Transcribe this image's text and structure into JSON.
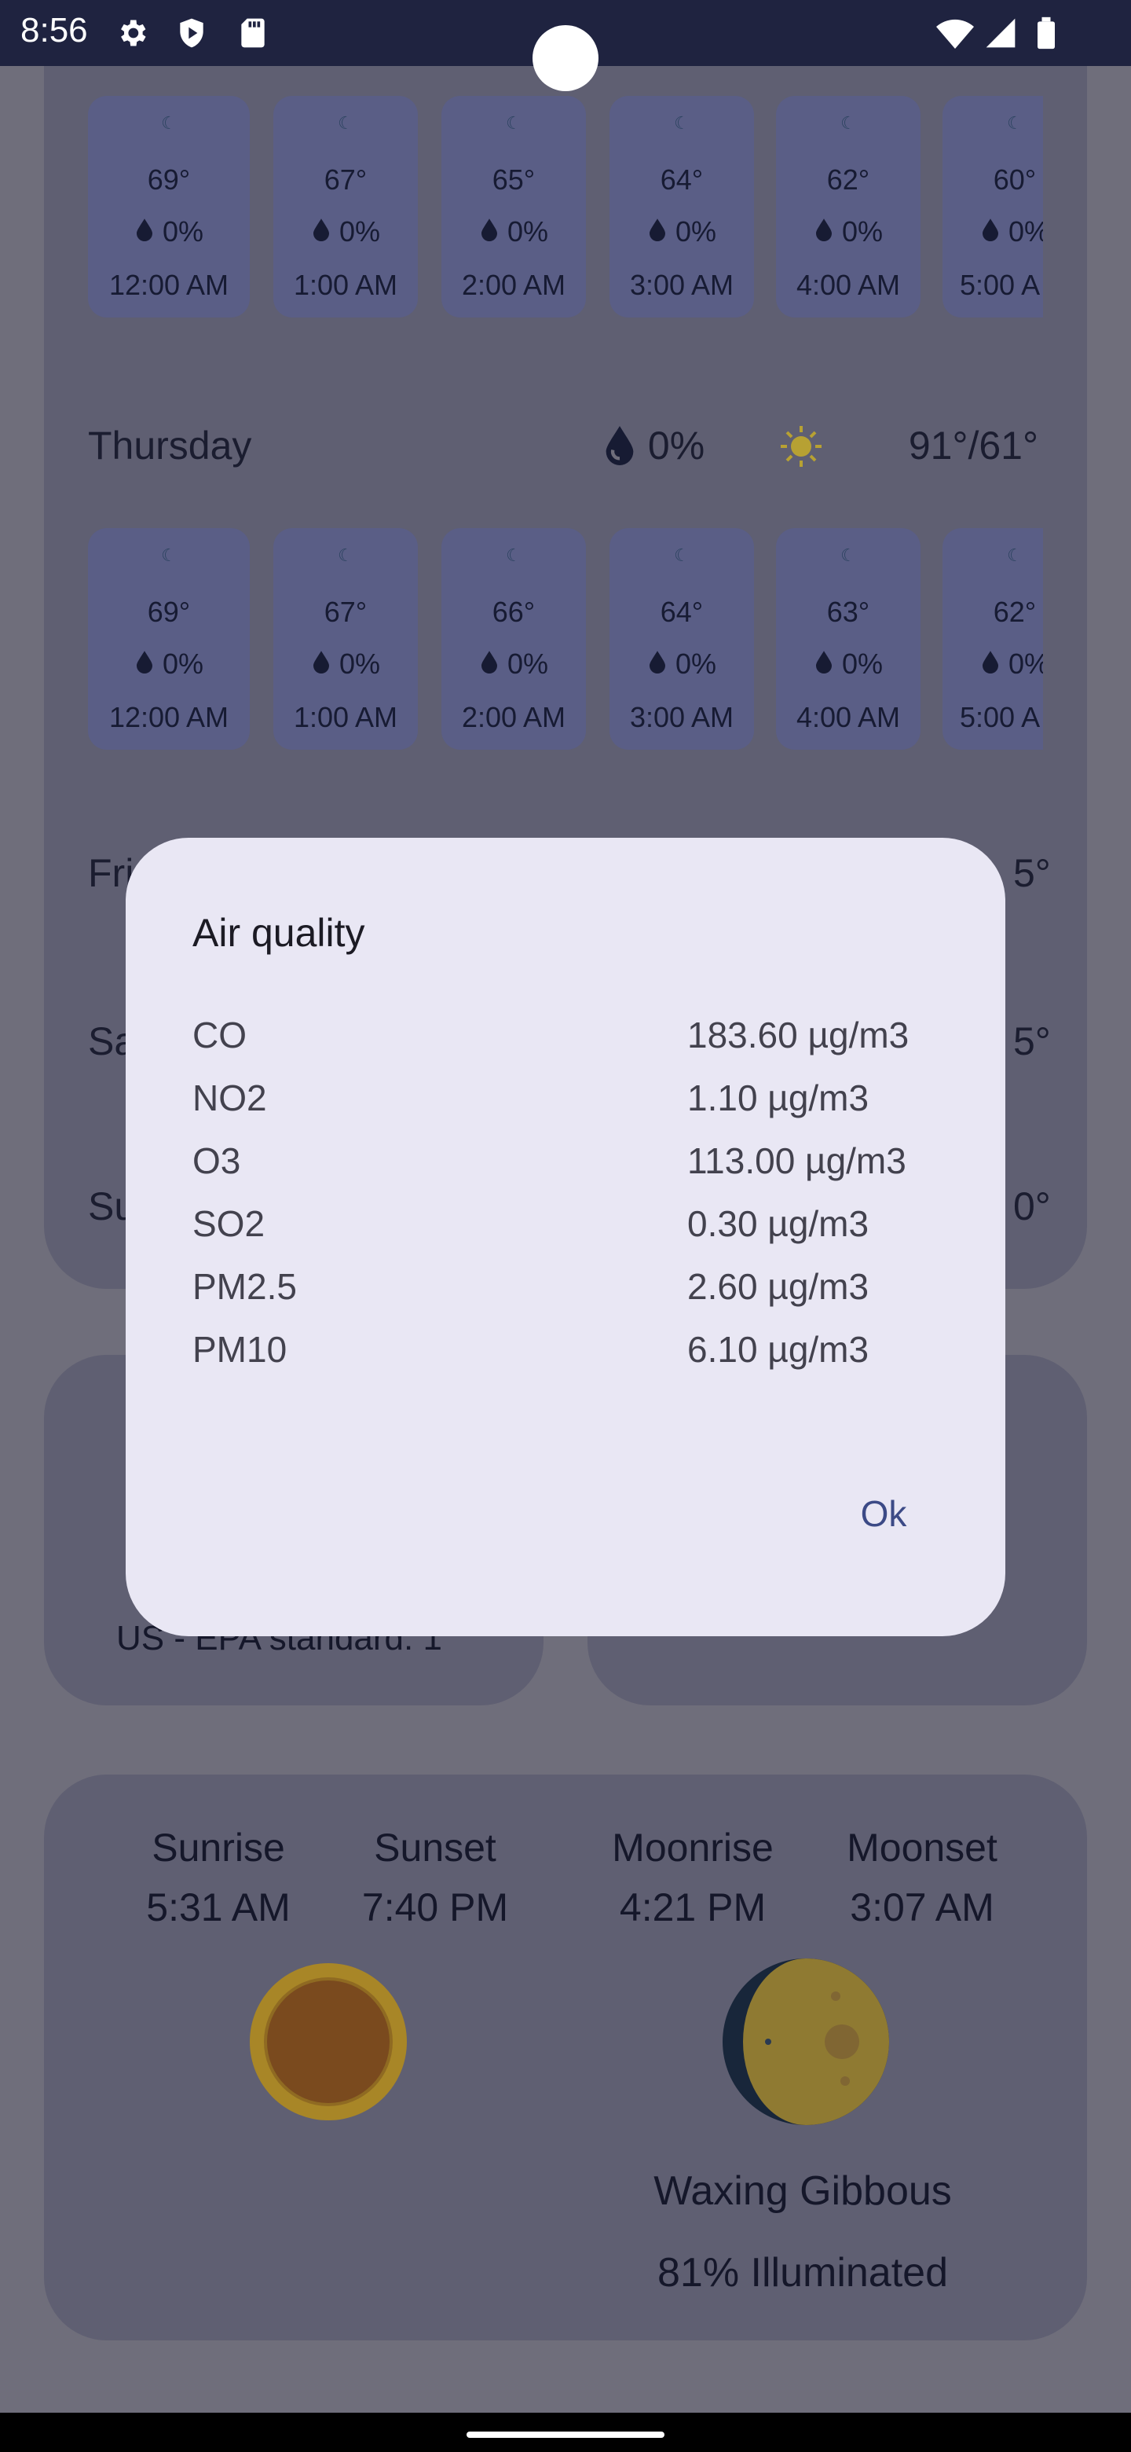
{
  "status_bar": {
    "time": "8:56"
  },
  "hourly_wednesday": [
    {
      "temp": "69°",
      "rain": "0%",
      "time": "12:00 AM"
    },
    {
      "temp": "67°",
      "rain": "0%",
      "time": "1:00 AM"
    },
    {
      "temp": "65°",
      "rain": "0%",
      "time": "2:00 AM"
    },
    {
      "temp": "64°",
      "rain": "0%",
      "time": "3:00 AM"
    },
    {
      "temp": "62°",
      "rain": "0%",
      "time": "4:00 AM"
    },
    {
      "temp": "60°",
      "rain": "0%",
      "time": "5:00 A"
    }
  ],
  "thursday": {
    "name": "Thursday",
    "rain": "0%",
    "temp": "91°/61°"
  },
  "hourly_thursday": [
    {
      "temp": "69°",
      "rain": "0%",
      "time": "12:00 AM"
    },
    {
      "temp": "67°",
      "rain": "0%",
      "time": "1:00 AM"
    },
    {
      "temp": "66°",
      "rain": "0%",
      "time": "2:00 AM"
    },
    {
      "temp": "64°",
      "rain": "0%",
      "time": "3:00 AM"
    },
    {
      "temp": "63°",
      "rain": "0%",
      "time": "4:00 AM"
    },
    {
      "temp": "62°",
      "rain": "0%",
      "time": "5:00 A"
    }
  ],
  "hidden_days": {
    "fri": "Fri",
    "sat": "Sa",
    "sun": "Su",
    "fri_temp": "5°",
    "sat_temp": "5°",
    "sun_temp": "0°"
  },
  "aqi_card": {
    "standard": "US - EPA standard: 1"
  },
  "sun_moon": {
    "sunrise_label": "Sunrise",
    "sunrise": "5:31 AM",
    "sunset_label": "Sunset",
    "sunset": "7:40 PM",
    "moonrise_label": "Moonrise",
    "moonrise": "4:21 PM",
    "moonset_label": "Moonset",
    "moonset": "3:07 AM",
    "phase": "Waxing Gibbous",
    "illumination": "81% Illuminated"
  },
  "dialog": {
    "title": "Air quality",
    "rows": [
      {
        "name": "CO",
        "value": "183.60 µg/m3"
      },
      {
        "name": "NO2",
        "value": "1.10 µg/m3"
      },
      {
        "name": "O3",
        "value": "113.00 µg/m3"
      },
      {
        "name": "SO2",
        "value": "0.30 µg/m3"
      },
      {
        "name": "PM2.5",
        "value": "2.60 µg/m3"
      },
      {
        "name": "PM10",
        "value": "6.10 µg/m3"
      }
    ],
    "ok": "Ok"
  }
}
